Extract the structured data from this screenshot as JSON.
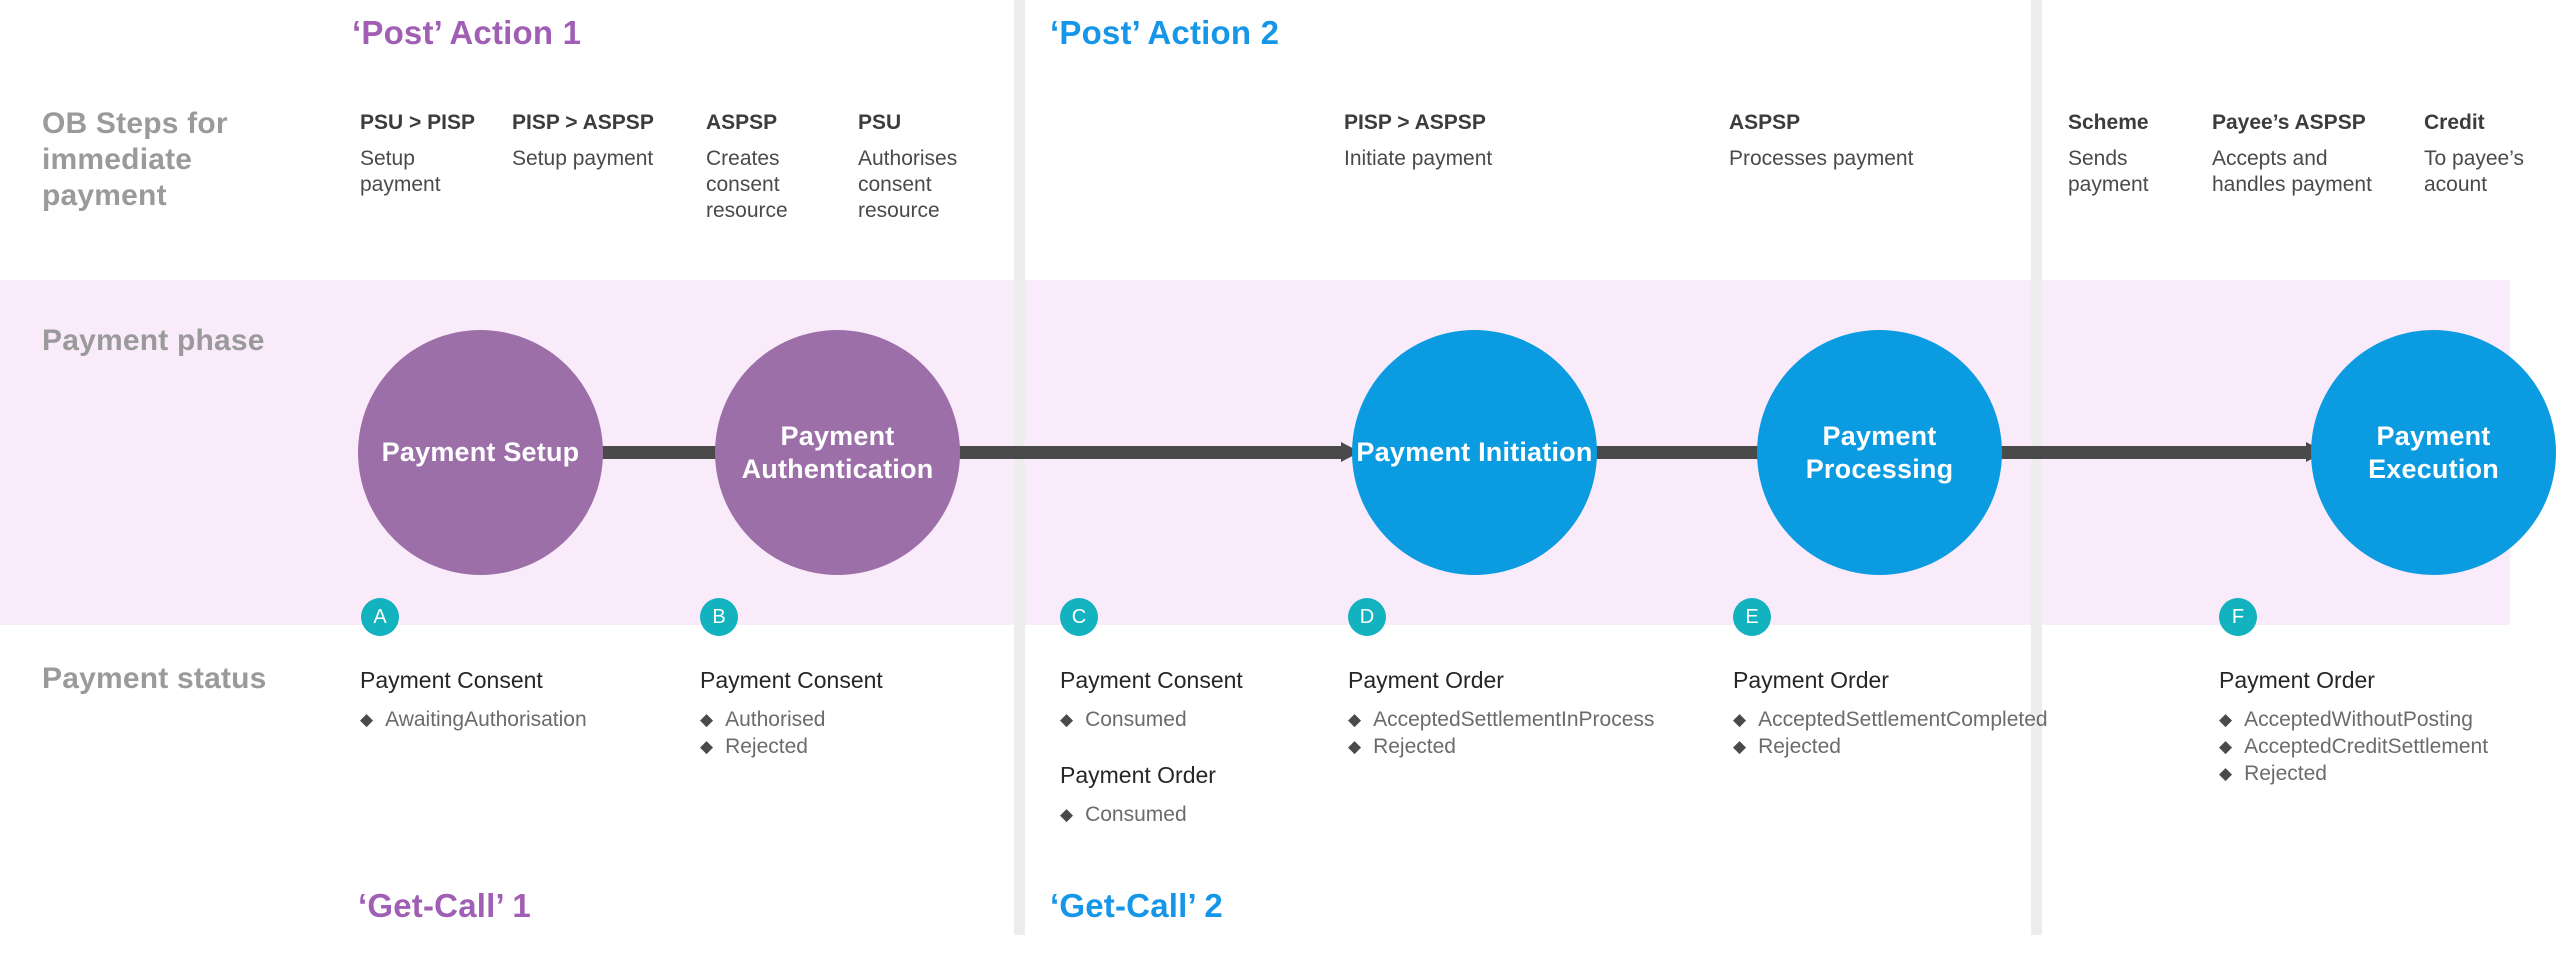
{
  "rows": {
    "steps_label": "OB Steps for immediate payment",
    "phase_label": "Payment phase",
    "status_label": "Payment status"
  },
  "sections": {
    "post1": "‘Post’ Action 1",
    "post2": "‘Post’ Action 2",
    "get1": "‘Get-Call’ 1",
    "get2": "‘Get-Call’ 2"
  },
  "colors": {
    "purple": "#9c6fa9",
    "blue": "#0b9be0",
    "teal": "#12b2be",
    "band": "#f9ebfa",
    "arrow": "#4a4a4a",
    "divider": "#ededed",
    "row_label": "#9a9a9a",
    "purple_title": "#a05fb4",
    "blue_title": "#1596e8"
  },
  "steps": [
    {
      "actor": "PSU > PISP",
      "desc": "Setup payment"
    },
    {
      "actor": "PISP > ASPSP",
      "desc": "Setup payment"
    },
    {
      "actor": "ASPSP",
      "desc": "Creates consent resource"
    },
    {
      "actor": "PSU",
      "desc": "Authorises consent resource"
    },
    {
      "actor": "PISP > ASPSP",
      "desc": "Initiate payment"
    },
    {
      "actor": "ASPSP",
      "desc": "Processes payment"
    },
    {
      "actor": "Scheme",
      "desc": "Sends payment"
    },
    {
      "actor": "Payee’s ASPSP",
      "desc": "Accepts and handles payment"
    },
    {
      "actor": "Credit",
      "desc": "To payee’s acount"
    }
  ],
  "nodes": [
    {
      "label": "Payment Setup",
      "color": "purple"
    },
    {
      "label": "Payment Authentication",
      "color": "purple"
    },
    {
      "label": "Payment Initiation",
      "color": "blue"
    },
    {
      "label": "Payment Processing",
      "color": "blue"
    },
    {
      "label": "Payment Execution",
      "color": "blue"
    }
  ],
  "badges": [
    {
      "letter": "A"
    },
    {
      "letter": "B"
    },
    {
      "letter": "C"
    },
    {
      "letter": "D"
    },
    {
      "letter": "E"
    },
    {
      "letter": "F"
    }
  ],
  "bullet_glyph": "◆",
  "status_columns": [
    {
      "badge": "A",
      "blocks": [
        {
          "title": "Payment Consent",
          "items": [
            "AwaitingAuthorisation"
          ]
        }
      ]
    },
    {
      "badge": "B",
      "blocks": [
        {
          "title": "Payment Consent",
          "items": [
            "Authorised",
            "Rejected"
          ]
        }
      ]
    },
    {
      "badge": "C",
      "blocks": [
        {
          "title": "Payment Consent",
          "items": [
            "Consumed"
          ]
        },
        {
          "title": "Payment Order",
          "items": [
            "Consumed"
          ]
        }
      ]
    },
    {
      "badge": "D",
      "blocks": [
        {
          "title": "Payment Order",
          "items": [
            "AcceptedSettlementInProcess",
            "Rejected"
          ]
        }
      ]
    },
    {
      "badge": "E",
      "blocks": [
        {
          "title": "Payment Order",
          "items": [
            "AcceptedSettlementCompleted",
            "Rejected"
          ]
        }
      ]
    },
    {
      "badge": "F",
      "blocks": [
        {
          "title": "Payment Order",
          "items": [
            "AcceptedWithoutPosting",
            "AcceptedCreditSettlement",
            "Rejected"
          ]
        }
      ]
    }
  ]
}
